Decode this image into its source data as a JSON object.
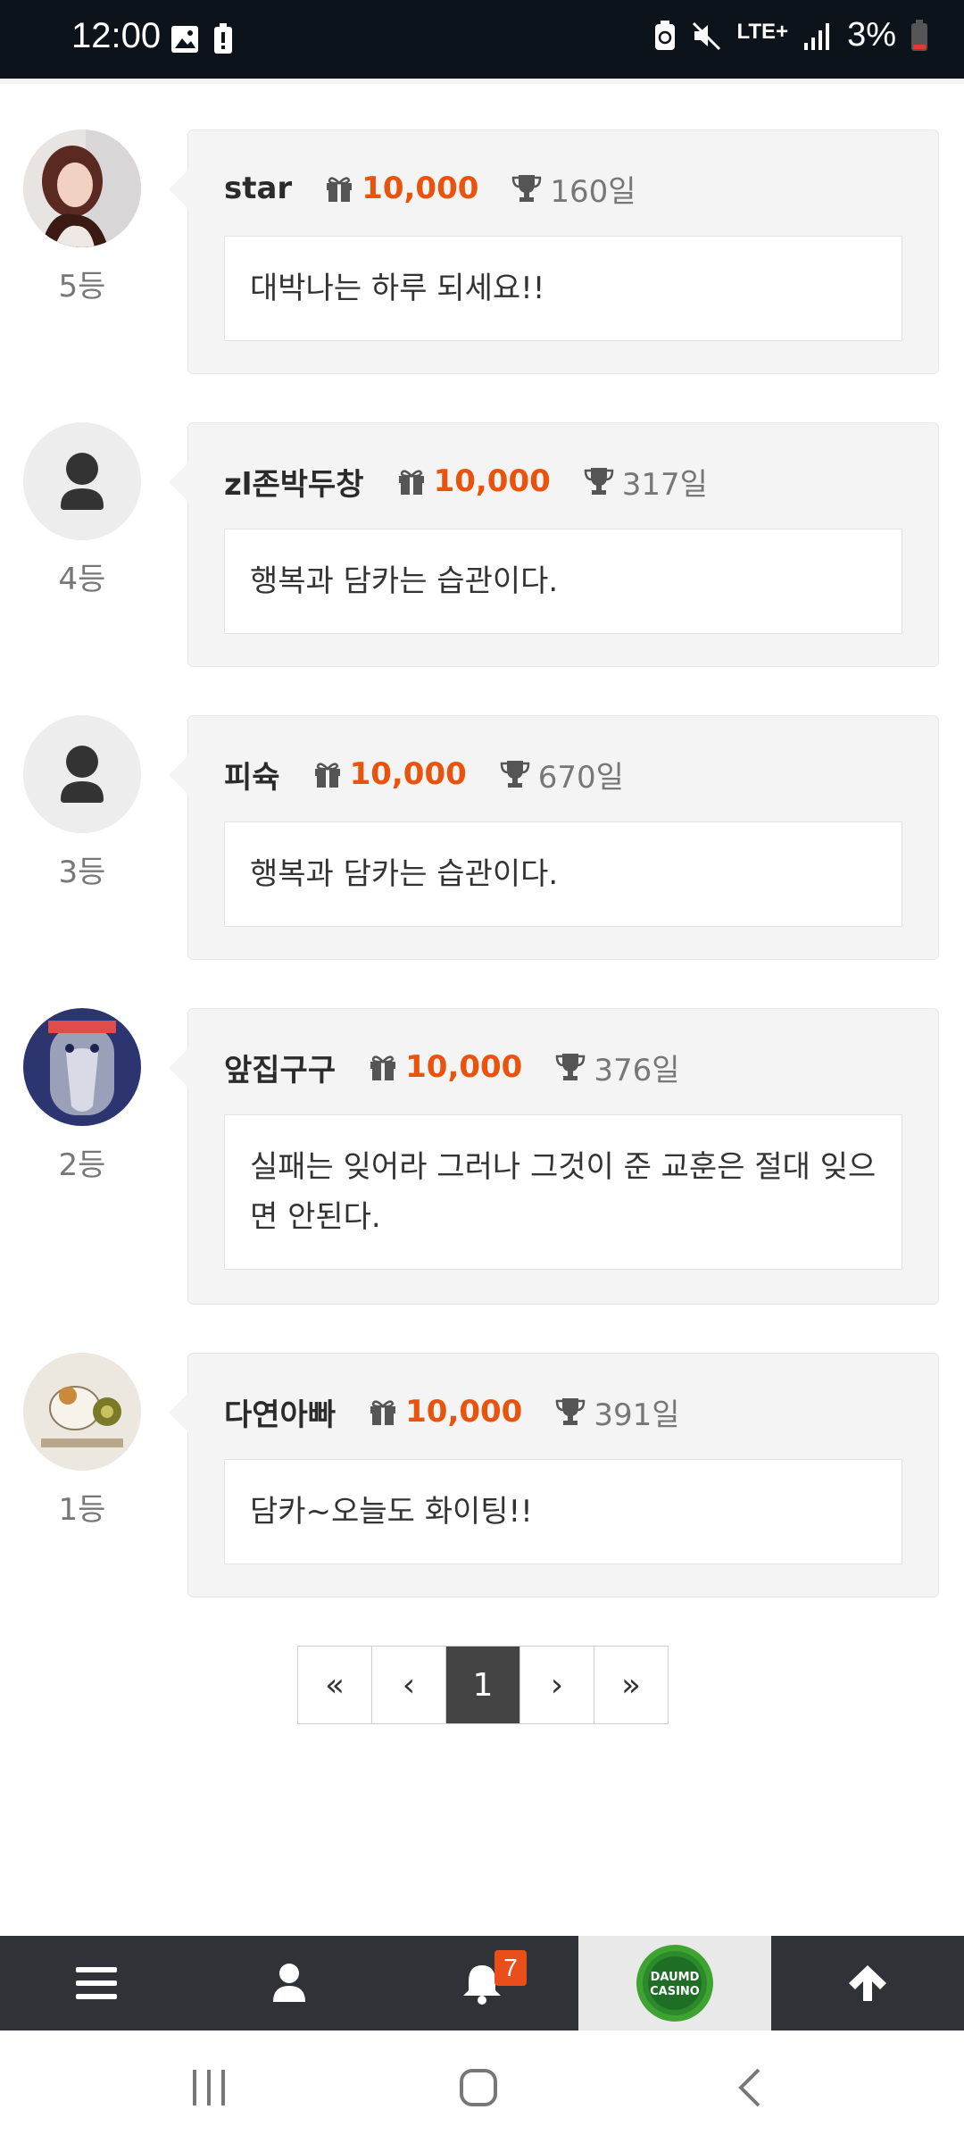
{
  "status_bar": {
    "time": "12:00",
    "network": "LTE+",
    "battery": "3%"
  },
  "comments": [
    {
      "author": "star",
      "points": "10,000",
      "days": "160일",
      "rank": "5등",
      "message": "대박나는 하루 되세요!!",
      "avatar": "photo-woman"
    },
    {
      "author": "zl존박두창",
      "points": "10,000",
      "days": "317일",
      "rank": "4등",
      "message": "행복과 담카는 습관이다.",
      "avatar": "default-user"
    },
    {
      "author": "피슉",
      "points": "10,000",
      "days": "670일",
      "rank": "3등",
      "message": "행복과 담카는 습관이다.",
      "avatar": "default-user"
    },
    {
      "author": "앞집구구",
      "points": "10,000",
      "days": "376일",
      "rank": "2등",
      "message": "실패는 잊어라 그러나 그것이 준 교훈은 절대 잊으면 안된다.",
      "avatar": "cartoon-blue"
    },
    {
      "author": "다연아빠",
      "points": "10,000",
      "days": "391일",
      "rank": "1등",
      "message": "담카~오늘도 화이팅!!",
      "avatar": "cartoon-hamster"
    }
  ],
  "pagination": {
    "first": "«",
    "prev": "‹",
    "current": "1",
    "next": "›",
    "last": "»"
  },
  "bottom_nav": {
    "notification_count": "7",
    "logo_text_top": "DAUMD",
    "logo_text_bottom": "CASINO",
    "items": [
      "menu-icon",
      "user-icon",
      "bell-icon",
      "brand-logo",
      "arrow-up-icon"
    ]
  },
  "colors": {
    "accent": "#e8530e",
    "nav_bg": "#2f3338",
    "status_bg": "#0d131b"
  }
}
